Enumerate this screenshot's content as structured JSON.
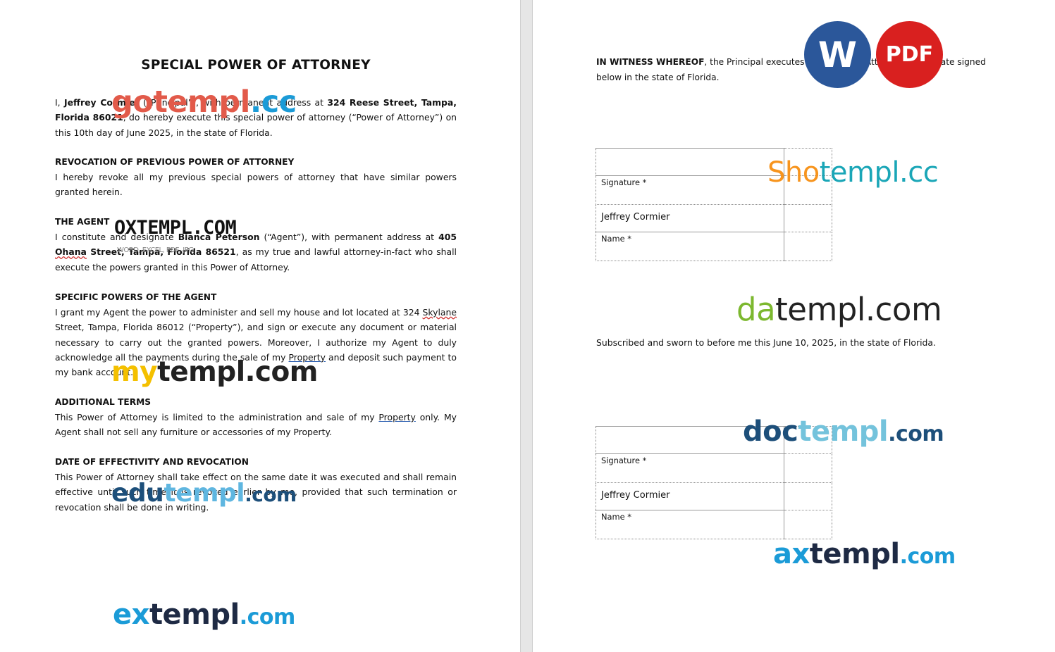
{
  "document": {
    "title": "SPECIAL POWER OF ATTORNEY",
    "intro": {
      "p1": "I, ",
      "principal_name": "Jeffrey Cormier",
      "p2": " (“Principal”), with permanent address at ",
      "principal_address": "324 Reese Street, Tampa, Florida 86021",
      "p3": ", do hereby execute this special power of attorney (“Power of Attorney”) on this 10th day of June 2025, in the state of Florida."
    },
    "sections": [
      {
        "heading": "REVOCATION OF PREVIOUS POWER OF ATTORNEY",
        "text": "I hereby revoke all my previous special powers of attorney that have similar powers granted herein."
      },
      {
        "heading": "THE AGENT",
        "t1": "I constitute and designate ",
        "agent_name": "Bianca Peterson",
        "t2": " (“Agent”), with permanent address at ",
        "agent_address_1": "405 ",
        "agent_address_2": "Ohana",
        "agent_address_3": " Street, Tampa, Florida 86521",
        "t3": ", as my true and lawful attorney-in-fact who shall execute the powers granted in this Power of Attorney."
      },
      {
        "heading": "SPECIFIC POWERS OF THE AGENT",
        "t1": "I grant my Agent the power to administer and sell my house and lot located at 324 ",
        "skylane": "Skylane",
        "t2": " Street, Tampa, Florida 86012 (“Property”), and sign or execute any document or material necessary to carry out the granted powers. Moreover, I authorize my Agent to duly acknowledge all the payments during the sale of my ",
        "property": "Property",
        "t3": " and deposit such payment to my bank account."
      },
      {
        "heading": "ADDITIONAL TERMS",
        "t1": "This Power of Attorney is limited to the administration and sale of my ",
        "property": "Property",
        "t2": " only. My Agent shall not sell any furniture or accessories of my Property."
      },
      {
        "heading": "DATE OF EFFECTIVITY AND REVOCATION",
        "text": "This Power of Attorney shall take effect on the same date it was executed and shall remain effective until such time it is revoked earlier by me, provided that such termination or revocation shall be done in writing."
      }
    ],
    "witness": {
      "lead": "IN WITNESS WHEREOF",
      "text": ", the Principal executes this Power of Attorney on the date signed below in the state of Florida."
    },
    "signature_block_1": {
      "signature_label": "Signature *",
      "name_value": "Jeffrey Cormier",
      "name_label": "Name *"
    },
    "sworn_text": "Subscribed and sworn to before me this June 10, 2025, in the state of Florida.",
    "signature_block_2": {
      "signature_label": "Signature *",
      "name_value": "Jeffrey Cormier",
      "name_label": "Name *"
    }
  },
  "badges": {
    "word": "W",
    "pdf": "PDF",
    "word_color": "#2b579a",
    "pdf_color": "#d9201f"
  },
  "watermarks": {
    "gotempl_a": "gotempl",
    "gotempl_b": ".cc",
    "oxtempl": "OXTEMPL.COM",
    "oxtempl_sub": "WORD, EXCEL, PDF, JPG",
    "mytempl_a": "my",
    "mytempl_b": "templ.com",
    "edutempl_a": "edu",
    "edutempl_b": "templ",
    "edutempl_c": ".com",
    "extempl_a": "ex",
    "extempl_b": "templ",
    "extempl_c": ".com",
    "shotempl_a": "Sho",
    "shotempl_b": "templ.cc",
    "datempl_a": "da",
    "datempl_b": "templ.com",
    "doctempl_a": "doc",
    "doctempl_b": "templ",
    "doctempl_c": ".com",
    "axtempl_a": "ax",
    "axtempl_b": "templ",
    "axtempl_c": ".com"
  }
}
